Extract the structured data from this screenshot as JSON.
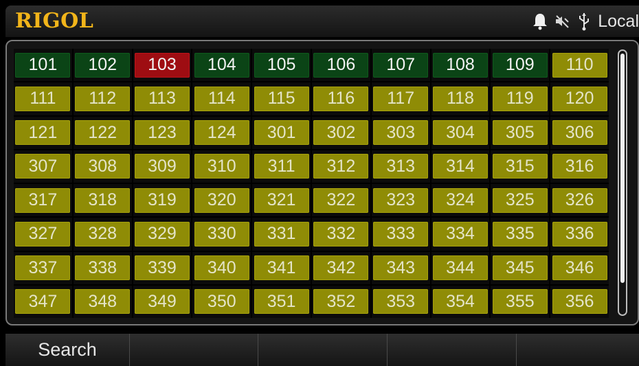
{
  "header": {
    "logo": "RIGOL",
    "status_icons": [
      "bell-icon",
      "speaker-muted-icon",
      "usb-icon"
    ],
    "mode": "Local"
  },
  "colors": {
    "logo": "#f2b51a",
    "green": "#0b4416",
    "red": "#9e0d12",
    "olive": "#8f8c06"
  },
  "channels": [
    {
      "label": "101",
      "state": "green"
    },
    {
      "label": "102",
      "state": "green"
    },
    {
      "label": "103",
      "state": "red"
    },
    {
      "label": "104",
      "state": "green"
    },
    {
      "label": "105",
      "state": "green"
    },
    {
      "label": "106",
      "state": "green"
    },
    {
      "label": "107",
      "state": "green"
    },
    {
      "label": "108",
      "state": "green"
    },
    {
      "label": "109",
      "state": "green"
    },
    {
      "label": "110",
      "state": "olive"
    },
    {
      "label": "111",
      "state": "olive"
    },
    {
      "label": "112",
      "state": "olive"
    },
    {
      "label": "113",
      "state": "olive"
    },
    {
      "label": "114",
      "state": "olive"
    },
    {
      "label": "115",
      "state": "olive"
    },
    {
      "label": "116",
      "state": "olive"
    },
    {
      "label": "117",
      "state": "olive"
    },
    {
      "label": "118",
      "state": "olive"
    },
    {
      "label": "119",
      "state": "olive"
    },
    {
      "label": "120",
      "state": "olive"
    },
    {
      "label": "121",
      "state": "olive"
    },
    {
      "label": "122",
      "state": "olive"
    },
    {
      "label": "123",
      "state": "olive"
    },
    {
      "label": "124",
      "state": "olive"
    },
    {
      "label": "301",
      "state": "olive"
    },
    {
      "label": "302",
      "state": "olive"
    },
    {
      "label": "303",
      "state": "olive"
    },
    {
      "label": "304",
      "state": "olive"
    },
    {
      "label": "305",
      "state": "olive"
    },
    {
      "label": "306",
      "state": "olive"
    },
    {
      "label": "307",
      "state": "olive"
    },
    {
      "label": "308",
      "state": "olive"
    },
    {
      "label": "309",
      "state": "olive"
    },
    {
      "label": "310",
      "state": "olive"
    },
    {
      "label": "311",
      "state": "olive"
    },
    {
      "label": "312",
      "state": "olive"
    },
    {
      "label": "313",
      "state": "olive"
    },
    {
      "label": "314",
      "state": "olive"
    },
    {
      "label": "315",
      "state": "olive"
    },
    {
      "label": "316",
      "state": "olive"
    },
    {
      "label": "317",
      "state": "olive"
    },
    {
      "label": "318",
      "state": "olive"
    },
    {
      "label": "319",
      "state": "olive"
    },
    {
      "label": "320",
      "state": "olive"
    },
    {
      "label": "321",
      "state": "olive"
    },
    {
      "label": "322",
      "state": "olive"
    },
    {
      "label": "323",
      "state": "olive"
    },
    {
      "label": "324",
      "state": "olive"
    },
    {
      "label": "325",
      "state": "olive"
    },
    {
      "label": "326",
      "state": "olive"
    },
    {
      "label": "327",
      "state": "olive"
    },
    {
      "label": "328",
      "state": "olive"
    },
    {
      "label": "329",
      "state": "olive"
    },
    {
      "label": "330",
      "state": "olive"
    },
    {
      "label": "331",
      "state": "olive"
    },
    {
      "label": "332",
      "state": "olive"
    },
    {
      "label": "333",
      "state": "olive"
    },
    {
      "label": "334",
      "state": "olive"
    },
    {
      "label": "335",
      "state": "olive"
    },
    {
      "label": "336",
      "state": "olive"
    },
    {
      "label": "337",
      "state": "olive"
    },
    {
      "label": "338",
      "state": "olive"
    },
    {
      "label": "339",
      "state": "olive"
    },
    {
      "label": "340",
      "state": "olive"
    },
    {
      "label": "341",
      "state": "olive"
    },
    {
      "label": "342",
      "state": "olive"
    },
    {
      "label": "343",
      "state": "olive"
    },
    {
      "label": "344",
      "state": "olive"
    },
    {
      "label": "345",
      "state": "olive"
    },
    {
      "label": "346",
      "state": "olive"
    },
    {
      "label": "347",
      "state": "olive"
    },
    {
      "label": "348",
      "state": "olive"
    },
    {
      "label": "349",
      "state": "olive"
    },
    {
      "label": "350",
      "state": "olive"
    },
    {
      "label": "351",
      "state": "olive"
    },
    {
      "label": "352",
      "state": "olive"
    },
    {
      "label": "353",
      "state": "olive"
    },
    {
      "label": "354",
      "state": "olive"
    },
    {
      "label": "355",
      "state": "olive"
    },
    {
      "label": "356",
      "state": "olive"
    }
  ],
  "softkeys": [
    "Search",
    "",
    "",
    "",
    ""
  ]
}
